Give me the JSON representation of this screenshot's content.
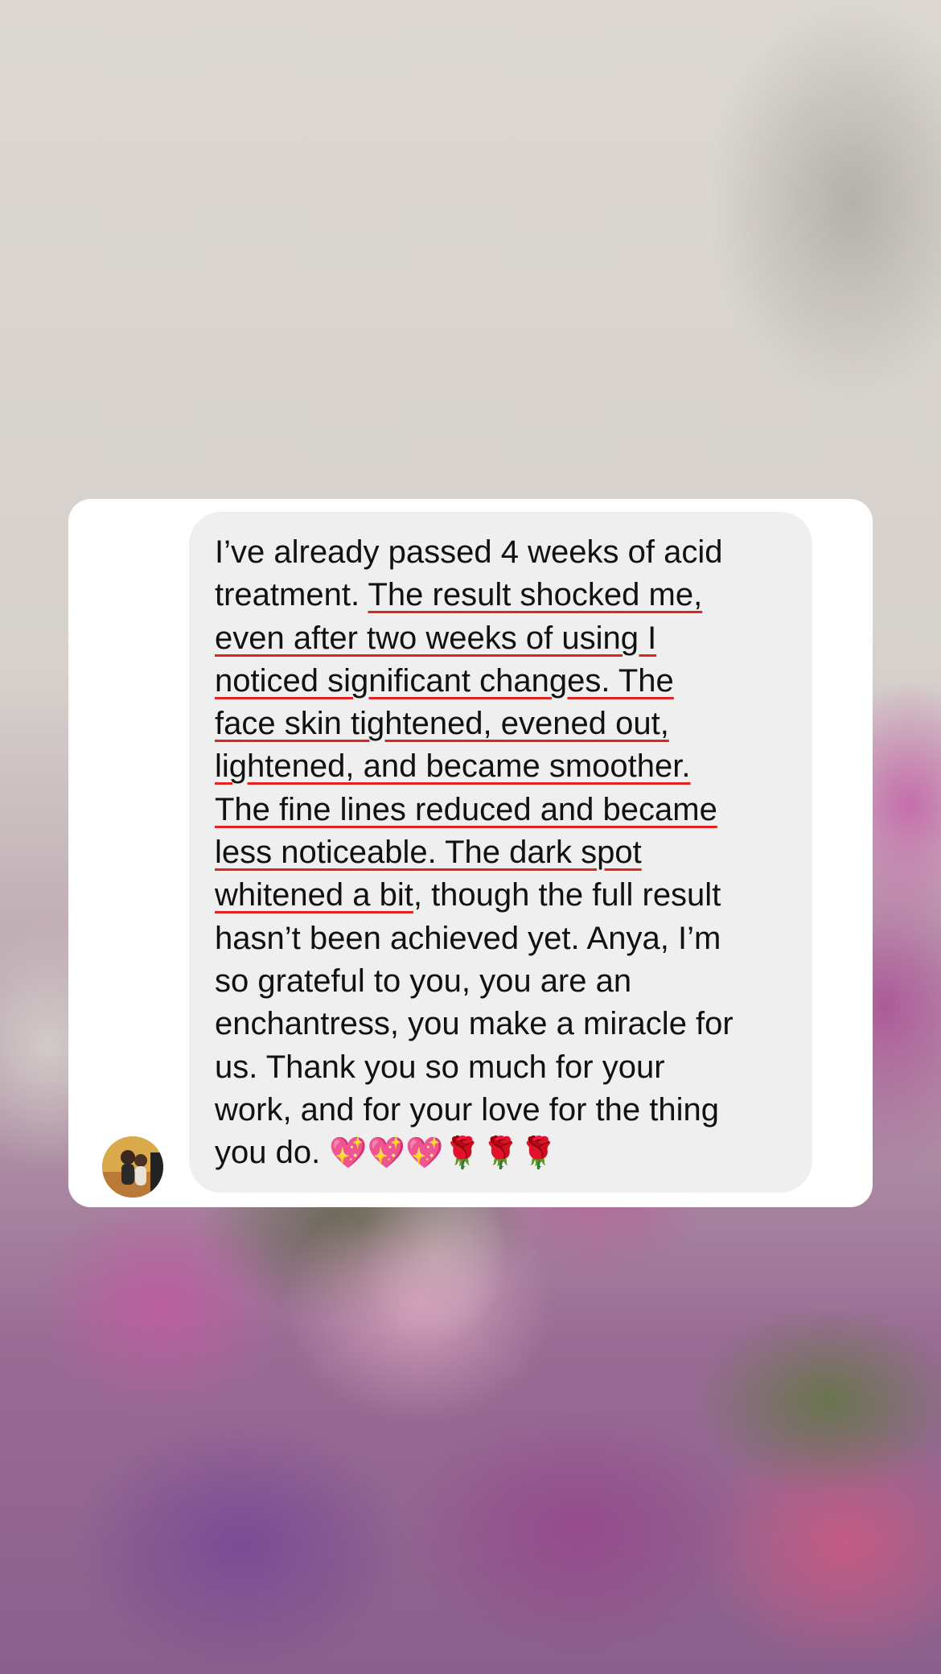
{
  "message": {
    "lines": [
      [
        "I’ve already passed 4 weeks of acid",
        ""
      ],
      [
        "treatment. ",
        "The result shocked me,"
      ],
      [
        "",
        "even after two weeks of using I"
      ],
      [
        "",
        "noticed significant changes. The"
      ],
      [
        "",
        "face skin tightened, evened out,"
      ],
      [
        "",
        "lightened, and became smoother."
      ],
      [
        "",
        "The fine lines reduced and became"
      ],
      [
        "",
        "less noticeable. The dark spot"
      ],
      [
        "",
        "whitened a bit",
        ", though the full result"
      ],
      [
        "hasn’t been achieved yet. Anya, I’m",
        ""
      ],
      [
        "so grateful to you, you are an",
        ""
      ],
      [
        "enchantress, you make a miracle for",
        ""
      ],
      [
        "us. Thank you so much for your",
        ""
      ],
      [
        "work, and for your love for the thing",
        ""
      ]
    ],
    "last_line_text": "you do. ",
    "emojis": "💖💖💖🌹🌹🌹"
  },
  "colors": {
    "underline": "#e02424",
    "bubble": "#efefef",
    "card": "#ffffff"
  }
}
